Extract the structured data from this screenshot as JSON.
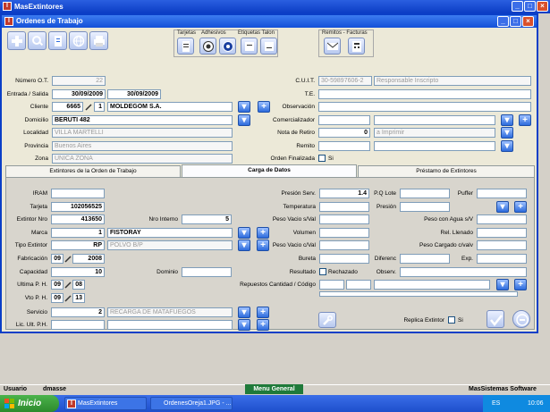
{
  "app": {
    "title": "MasExtintores"
  },
  "window": {
    "title": "Ordenes de Trabajo"
  },
  "toolbar": {
    "group_tarjetas": "Tarjetas",
    "group_adhesivos": "Adhesivos",
    "group_etiquetas": "Etiquetas Talon",
    "group_remitos": "Remitos - Facturas"
  },
  "header": {
    "numero_ot_label": "Número O.T.",
    "numero_ot": "22",
    "entrada_salida_label": "Entrada / Salida",
    "entrada": "30/09/2009",
    "salida": "30/09/2009",
    "cliente_label": "Cliente",
    "cliente_codigo": "6665",
    "cliente_sub": "1",
    "cliente_nombre": "MOLDEGOM S.A.",
    "domicilio_label": "Domicilio",
    "domicilio": "BERUTI 482",
    "localidad_label": "Localidad",
    "localidad": "VILLA MARTELLI",
    "provincia_label": "Provincia",
    "provincia": "Buenos Aires",
    "zona_label": "Zona",
    "zona": "UNICA ZONA",
    "cuit_label": "C.U.I.T.",
    "cuit": "30-59897606-2",
    "cuit_tipo": "Responsable Inscripto",
    "te_label": "T.E.",
    "observacion_label": "Observación",
    "comercializador_label": "Comercializador",
    "nota_retiro_label": "Nota de Retiro",
    "nota_retiro": "0",
    "nota_retiro_estado": "a Imprimir",
    "remito_label": "Remito",
    "orden_finalizada_label": "Orden Finalizada",
    "si_label": "Si"
  },
  "tabs": [
    {
      "label": "Extintores de la Orden de Trabajo"
    },
    {
      "label": "Carga de Datos"
    },
    {
      "label": "Préstamo de Extintores"
    }
  ],
  "carga": {
    "iram_label": "IRAM",
    "tarjeta_label": "Tarjeta",
    "tarjeta": "102056525",
    "extintor_nro_label": "Extintor Nro",
    "extintor_nro": "413650",
    "nro_interno_label": "Nro Interno",
    "nro_interno": "5",
    "marca_label": "Marca",
    "marca_codigo": "1",
    "marca_nombre": "FISTORAY",
    "tipo_extintor_label": "Tipo Extintor",
    "tipo_codigo": "RP",
    "tipo_nombre": "POLVO B/P",
    "fabricacion_label": "Fabricación",
    "fabricacion_mes": "09",
    "fabricacion_anio": "2008",
    "capacidad_label": "Capacidad",
    "capacidad": "10",
    "dominio_label": "Dominio",
    "ultima_ph_label": "Ultima  P. H.",
    "ultima_ph_mes": "09",
    "ultima_ph_anio": "08",
    "vto_ph_label": "Vto  P. H.",
    "vto_ph_mes": "09",
    "vto_ph_anio": "13",
    "servicio_label": "Servicio",
    "servicio_codigo": "2",
    "servicio_nombre": "RECARGA DE MATAFUEGOS",
    "lic_ult_ph_label": "Lic. Ult. P.H.",
    "presion_serv_label": "Presión Serv.",
    "presion_serv": "1.4",
    "temperatura_label": "Temperatura",
    "peso_vacio_val_label": "Peso Vacio s/Val",
    "volumen_label": "Volumen",
    "peso_vacio_cval_label": "Peso Vacio c/Val",
    "bureta_label": "Bureta",
    "resultado_label": "Resultado",
    "rechazado_label": "Rechazado",
    "repuestos_label": "Repuestos Cantidad / Código",
    "pq_lote_label": "P.Q Lote",
    "puffer_label": "Puffer",
    "presion_label": "Presión",
    "peso_agua_label": "Peso con Agua s/V",
    "rel_llenado_label": "Rel. Llenado",
    "peso_cargado_label": "Peso Cargado c/valv",
    "diferenc_label": "Diferenc",
    "exp_label": "Exp.",
    "observ_label": "Observ.",
    "replica_label": "Replica Extintor",
    "si_label": "Si"
  },
  "status": {
    "usuario_label": "Usuario",
    "usuario": "dmasse",
    "menu_general": "Menu General",
    "company": "MasSistemas Software"
  },
  "taskbar": {
    "start": "Inicio",
    "task1": "MasExtintores",
    "task2": "OrdenesOreja1.JPG - ...",
    "lang": "ES",
    "clock": "10:06"
  }
}
